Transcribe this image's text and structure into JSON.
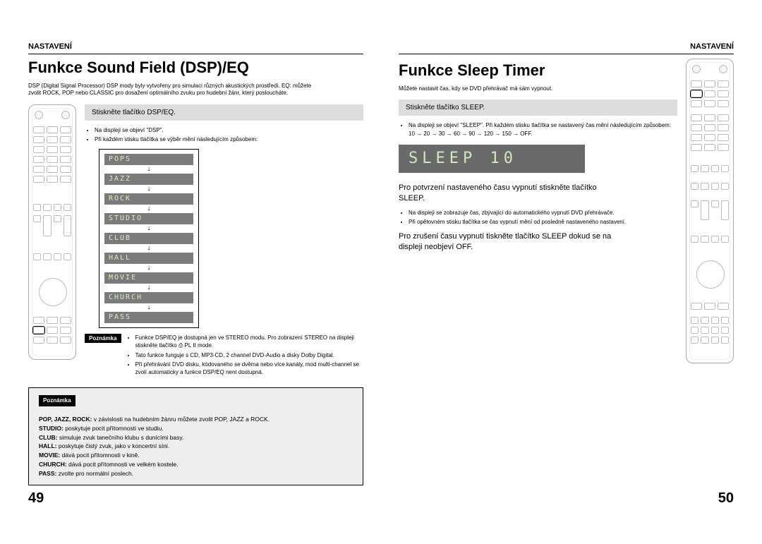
{
  "left": {
    "section": "NASTAVENÍ",
    "title": "Funkce Sound Field (DSP)/EQ",
    "intro": "DSP (Digital Signal Processor) DSP mody byly vytvořeny pro simulaci různých akustických prostředí. EQ: můžete zvolit ROCK, POP nebo CLASSIC pro dosažení optimálního zvuku pro hudební žánr, který posloucháte.",
    "step1_box": "Stiskněte tlačítko DSP/EQ.",
    "step1_bullets": [
      "Na displeji se objeví \"DSP\".",
      "Při každém stisku tlačítka se výběr mění následujícím způsobem:"
    ],
    "modes": [
      "POPS",
      "JAZZ",
      "ROCK",
      "STUDIO",
      "CLUB",
      "HALL",
      "MOVIE",
      "CHURCH",
      "PASS"
    ],
    "note_label": "Poznámka",
    "note1": [
      "Funkce DSP/EQ je dostupná jen ve STEREO modu. Pro zobrazení STEREO na displeji stiskněte tlačítko ⎙ PL II mode.",
      "Tato funkce funguje s CD, MP3-CD, 2 channel DVD-Audio a disky Dolby Digital.",
      "Při přehrávání DVD disku, kódovaného se dvěma nebo více kanály, mod multi-channel se zvolí automaticky a funkce DSP/EQ není dostupná."
    ],
    "footer_lines": [
      {
        "term": "POP, JAZZ, ROCK:",
        "desc": "v závislosti na hudebním žánru můžete zvolit POP, JAZZ a ROCK."
      },
      {
        "term": "STUDIO:",
        "desc": "poskytuje pocit přítomnosti ve studiu."
      },
      {
        "term": "CLUB:",
        "desc": "simuluje zvuk tanečního klubu s dunícími basy."
      },
      {
        "term": "HALL:",
        "desc": "poskytuje čistý zvuk, jako v koncertní síni."
      },
      {
        "term": "MOVIE:",
        "desc": "dává pocit přítomnosti v kině."
      },
      {
        "term": "CHURCH:",
        "desc": "dává pocit přítomnosti ve velkém kostele."
      },
      {
        "term": "PASS:",
        "desc": "zvolte pro normální poslech."
      }
    ],
    "page_num": "49"
  },
  "right": {
    "section": "NASTAVENÍ",
    "title": "Funkce Sleep Timer",
    "intro": "Můžete nastavit čas, kdy se DVD přehrávač má sám vypnout.",
    "step1_box": "Stiskněte tlačítko SLEEP.",
    "step1_bullets": [
      "Na displeji se objeví \"SLEEP\". Při každém stisku tlačítka se nastavený čas mění následujícím způsobem: 10 → 20 → 30 → 60 → 90 → 120 → 150 → OFF."
    ],
    "lcd": "SLEEP  10",
    "sub1": "Pro potvrzení nastaveného času vypnutí stiskněte tlačítko SLEEP.",
    "sub1_bullets": [
      "Na displeji se zobrazuje čas, zbývající do automatického vypnutí DVD přehrávače.",
      "Při opětovném stisku tlačítka se čas vypnutí mění od posledně nastaveného nastavení."
    ],
    "sub2": "Pro zrušení času vypnutí tiskněte tlačítko SLEEP dokud se na displeji neobjeví OFF.",
    "page_num": "50"
  }
}
